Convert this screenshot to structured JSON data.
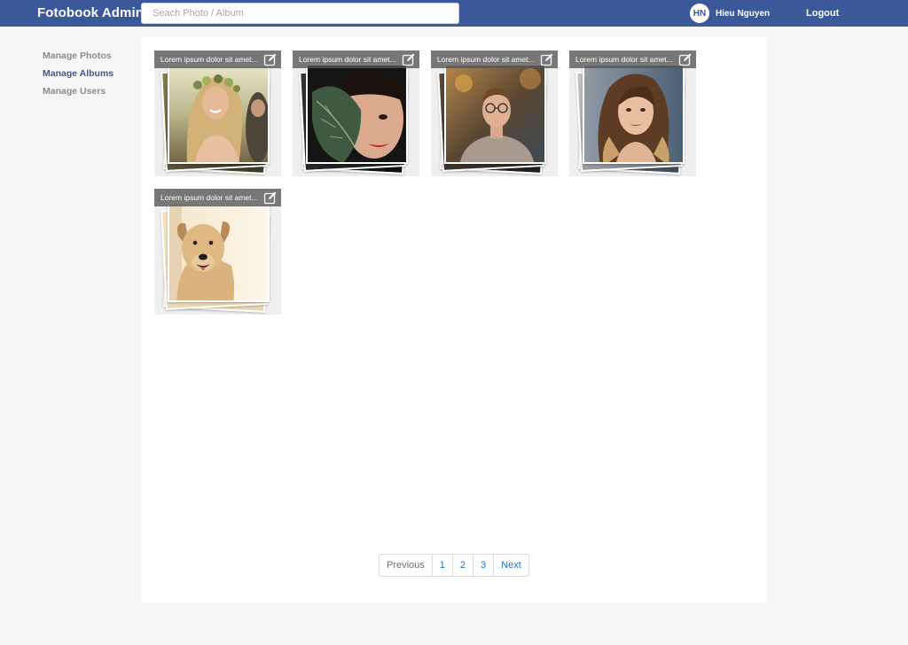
{
  "header": {
    "brand": "Fotobook Admin",
    "search_placeholder": "Seach Photo / Album",
    "user_initials": "HN",
    "user_name": "Hieu Nguyen",
    "logout_label": "Logout"
  },
  "sidebar": {
    "items": [
      {
        "label": "Manage Photos"
      },
      {
        "label": "Manage Albums"
      },
      {
        "label": "Manage Users"
      }
    ]
  },
  "albums": [
    {
      "title": "Lorem ipsum dolor sit amet..."
    },
    {
      "title": "Lorem ipsum dolor sit amet..."
    },
    {
      "title": "Lorem ipsum dolor sit amet..."
    },
    {
      "title": "Lorem ipsum dolor sit amet..."
    },
    {
      "title": "Lorem ipsum dolor sit amet..."
    }
  ],
  "pagination": {
    "previous": "Previous",
    "pages": [
      "1",
      "2",
      "3"
    ],
    "next": "Next"
  },
  "colors": {
    "brand": "#3b5998",
    "link": "#1a73d6"
  }
}
